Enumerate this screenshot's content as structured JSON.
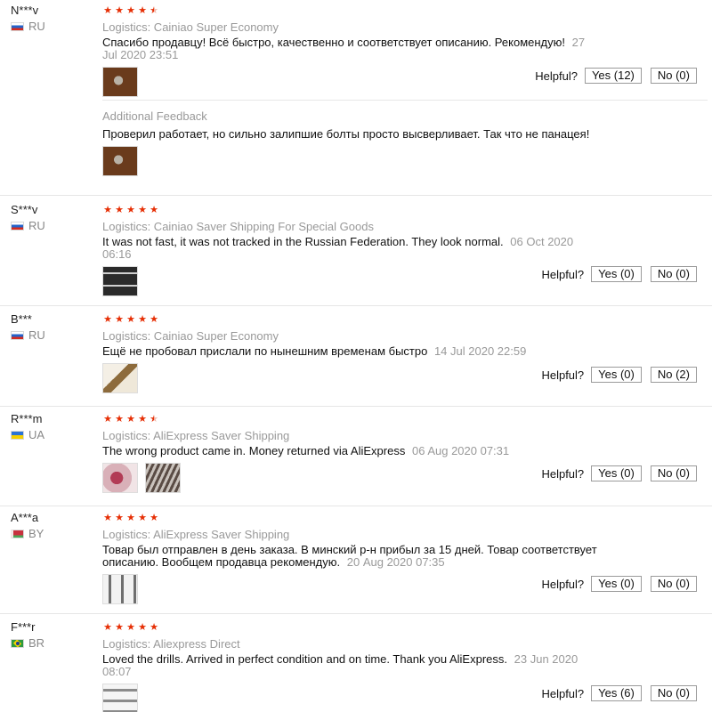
{
  "helpful_label": "Helpful?",
  "additional_feedback_label": "Additional Feedback",
  "reviews": [
    {
      "user": "N***v",
      "country": "RU",
      "rating": 4.5,
      "logistics": "Logistics: Cainiao Super Economy",
      "text": "Спасибо продавцу! Всё быстро, качественно и соответствует описанию. Рекомендую!",
      "date": "27 Jul 2020 23:51",
      "yes": "Yes (12)",
      "no": "No (0)",
      "additional_text": "Проверил работает, но сильно залипшие болты просто высверливает. Так что не панацея!"
    },
    {
      "user": "S***v",
      "country": "RU",
      "rating": 5,
      "logistics": "Logistics: Cainiao Saver Shipping For Special Goods",
      "text": "It was not fast, it was not tracked in the Russian Federation. They look normal.",
      "date": "06 Oct 2020 06:16",
      "yes": "Yes (0)",
      "no": "No (0)"
    },
    {
      "user": "B***",
      "country": "RU",
      "rating": 5,
      "logistics": "Logistics: Cainiao Super Economy",
      "text": "Ещё не пробовал прислали по нынешним временам быстро",
      "date": "14 Jul 2020 22:59",
      "yes": "Yes (0)",
      "no": "No (2)"
    },
    {
      "user": "R***m",
      "country": "UA",
      "rating": 4.5,
      "logistics": "Logistics: AliExpress Saver Shipping",
      "text": "The wrong product came in. Money returned via AliExpress",
      "date": "06 Aug 2020 07:31",
      "yes": "Yes (0)",
      "no": "No (0)"
    },
    {
      "user": "A***a",
      "country": "BY",
      "rating": 5,
      "logistics": "Logistics: AliExpress Saver Shipping",
      "text": "Товар был отправлен в день заказа. В минский р-н прибыл за 15 дней. Товар соответствует описанию. Вообщем продавца рекомендую.",
      "date": "20 Aug 2020 07:35",
      "yes": "Yes (0)",
      "no": "No (0)"
    },
    {
      "user": "F***r",
      "country": "BR",
      "rating": 5,
      "logistics": "Logistics: Aliexpress Direct",
      "text": "Loved the drills. Arrived in perfect condition and on time. Thank you AliExpress.",
      "date": "23 Jun 2020 08:07",
      "yes": "Yes (6)",
      "no": "No (0)"
    }
  ]
}
